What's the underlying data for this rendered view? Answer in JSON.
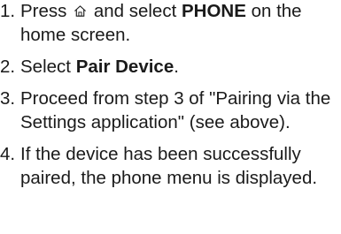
{
  "steps": [
    {
      "number": "1.",
      "parts": [
        "Press",
        "and select",
        "PHONE",
        "on the home screen."
      ],
      "icon": "home-icon"
    },
    {
      "number": "2.",
      "parts": [
        "Select",
        "Pair Device",
        "."
      ]
    },
    {
      "number": "3.",
      "text": "Proceed from step 3 of \"Pairing via the Settings application\" (see above)."
    },
    {
      "number": "4.",
      "text": "If the device has been successfully paired, the phone menu is displayed."
    }
  ]
}
